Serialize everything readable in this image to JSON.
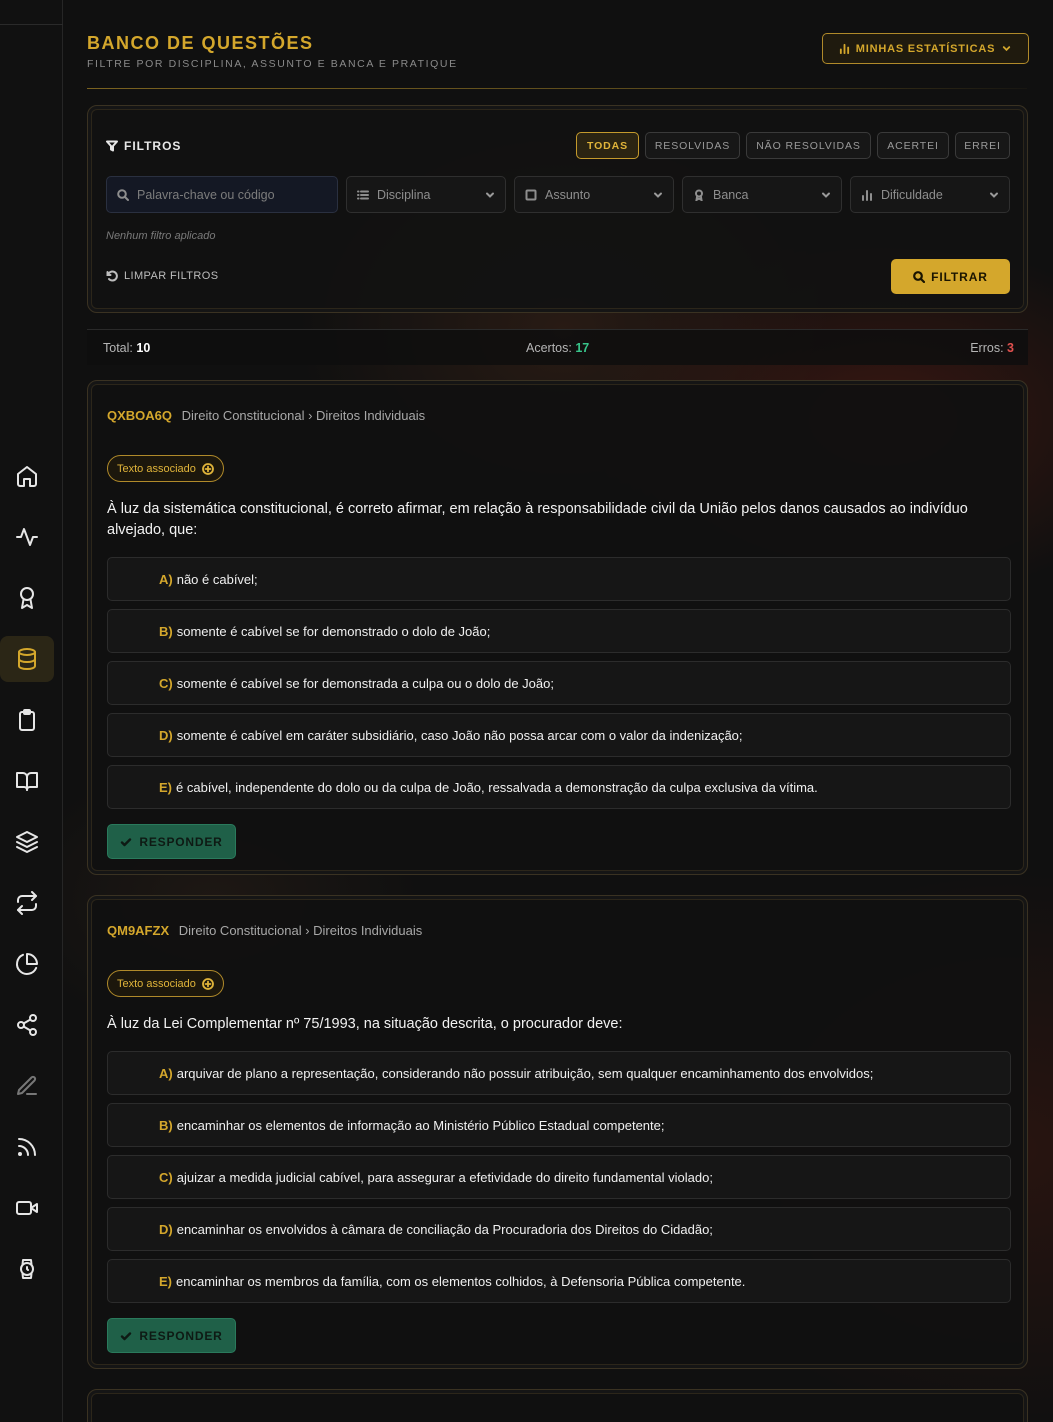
{
  "header": {
    "title": "BANCO DE QUESTÕES",
    "subtitle": "FILTRE POR DISCIPLINA, ASSUNTO E BANCA E PRATIQUE",
    "stats_button": "MINHAS ESTATÍSTICAS"
  },
  "sidebar": {
    "items": [
      {
        "icon": "home-icon"
      },
      {
        "icon": "activity-icon"
      },
      {
        "icon": "award-icon"
      },
      {
        "icon": "database-icon",
        "active": true
      },
      {
        "icon": "clipboard-icon"
      },
      {
        "icon": "book-open-icon"
      },
      {
        "icon": "layers-icon"
      },
      {
        "icon": "repeat-icon"
      },
      {
        "icon": "pie-chart-icon"
      },
      {
        "icon": "share-icon"
      },
      {
        "icon": "pen-icon"
      },
      {
        "icon": "rss-icon"
      },
      {
        "icon": "video-icon"
      },
      {
        "icon": "watch-icon"
      }
    ]
  },
  "filters": {
    "label": "FILTROS",
    "tabs": [
      "TODAS",
      "RESOLVIDAS",
      "NÃO RESOLVIDAS",
      "ACERTEI",
      "ERREI"
    ],
    "active_tab": "TODAS",
    "search_placeholder": "Palavra-chave ou código",
    "discipline": "Disciplina",
    "subject": "Assunto",
    "board": "Banca",
    "difficulty": "Dificuldade",
    "no_filter": "Nenhum filtro aplicado",
    "clear": "LIMPAR FILTROS",
    "apply": "FILTRAR"
  },
  "stats": {
    "total_label": "Total:",
    "total": "10",
    "correct_label": "Acertos:",
    "correct": "17",
    "wrong_label": "Erros:",
    "wrong": "3"
  },
  "questions": [
    {
      "code": "QXBOA6Q",
      "path": "Direito Constitucional › Direitos Individuais",
      "assoc_label": "Texto associado",
      "statement": "À luz da sistemática constitucional, é correto afirmar, em relação à responsabilidade civil da União pelos danos causados ao indivíduo alvejado, que:",
      "options": [
        {
          "letter": "A)",
          "text": "não é cabível;"
        },
        {
          "letter": "B)",
          "text": "somente é cabível se for demonstrado o dolo de João;"
        },
        {
          "letter": "C)",
          "text": "somente é cabível se for demonstrada a culpa ou o dolo de João;"
        },
        {
          "letter": "D)",
          "text": "somente é cabível em caráter subsidiário, caso João não possa arcar com o valor da indenização;"
        },
        {
          "letter": "E)",
          "text": "é cabível, independente do dolo ou da culpa de João, ressalvada a demonstração da culpa exclusiva da vítima."
        }
      ],
      "answer_button": "RESPONDER"
    },
    {
      "code": "QM9AFZX",
      "path": "Direito Constitucional › Direitos Individuais",
      "assoc_label": "Texto associado",
      "statement": "À luz da Lei Complementar nº 75/1993, na situação descrita, o procurador deve:",
      "options": [
        {
          "letter": "A)",
          "text": "arquivar de plano a representação, considerando não possuir atribuição, sem qualquer encaminhamento dos envolvidos;"
        },
        {
          "letter": "B)",
          "text": "encaminhar os elementos de informação ao Ministério Público Estadual competente;"
        },
        {
          "letter": "C)",
          "text": "ajuizar a medida judicial cabível, para assegurar a efetividade do direito fundamental violado;"
        },
        {
          "letter": "D)",
          "text": "encaminhar os envolvidos à câmara de conciliação da Procuradoria dos Direitos do Cidadão;"
        },
        {
          "letter": "E)",
          "text": "encaminhar os membros da família, com os elementos colhidos, à Defensoria Pública competente."
        }
      ],
      "answer_button": "RESPONDER"
    }
  ],
  "colors": {
    "accent": "#d4a72c",
    "success": "#38c48a",
    "danger": "#e0504e",
    "answer_button": "#1f6048"
  }
}
